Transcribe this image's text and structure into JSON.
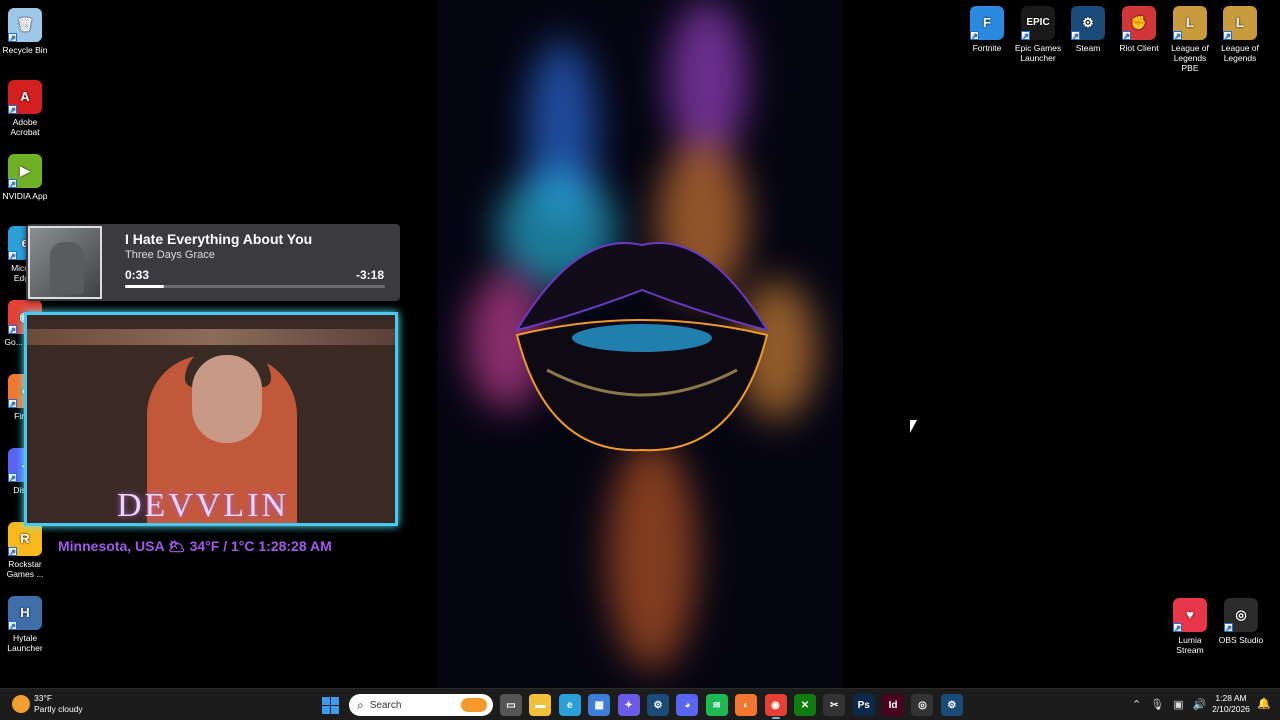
{
  "desktop_icons_left": [
    {
      "label": "Recycle Bin",
      "icon": "recycle-bin-icon",
      "glyph": "🗑",
      "color": "#9fc7e8"
    },
    {
      "label": "Adobe Acrobat",
      "icon": "adobe-acrobat-icon",
      "glyph": "A",
      "color": "#d21f1f"
    },
    {
      "label": "NVIDIA App",
      "icon": "nvidia-icon",
      "glyph": "▶",
      "color": "#6fb026"
    },
    {
      "label": "Micro... Edg...",
      "icon": "edge-icon",
      "glyph": "e",
      "color": "#2aa0d8"
    },
    {
      "label": "Go... Chr...",
      "icon": "chrome-icon",
      "glyph": "◉",
      "color": "#e44134"
    },
    {
      "label": "Fire...",
      "icon": "firefox-icon",
      "glyph": "◐",
      "color": "#f2762e"
    },
    {
      "label": "Disc...",
      "icon": "discord-icon",
      "glyph": "◕",
      "color": "#5865f2"
    },
    {
      "label": "Rockstar Games ...",
      "icon": "rockstar-icon",
      "glyph": "R",
      "color": "#f9b81b"
    },
    {
      "label": "Hytale Launcher",
      "icon": "hytale-icon",
      "glyph": "H",
      "color": "#3e6fa8"
    }
  ],
  "desktop_icons_right": [
    {
      "label": "Fortnite",
      "icon": "fortnite-icon",
      "glyph": "F",
      "color": "#2b8ae0"
    },
    {
      "label": "Epic Games Launcher",
      "icon": "epic-games-icon",
      "glyph": "EPIC",
      "color": "#1a1a1a"
    },
    {
      "label": "Steam",
      "icon": "steam-icon",
      "glyph": "⚙",
      "color": "#1b4b78"
    },
    {
      "label": "Riot Client",
      "icon": "riot-client-icon",
      "glyph": "✊",
      "color": "#d13639"
    },
    {
      "label": "League of Legends PBE",
      "icon": "league-pbe-icon",
      "glyph": "L",
      "color": "#c89b3c"
    },
    {
      "label": "League of Legends",
      "icon": "league-icon",
      "glyph": "L",
      "color": "#c89b3c"
    }
  ],
  "desktop_icons_bottom_right": [
    {
      "label": "Lumia Stream",
      "icon": "lumia-stream-icon",
      "glyph": "♥",
      "color": "#e8364b"
    },
    {
      "label": "OBS Studio",
      "icon": "obs-icon",
      "glyph": "◎",
      "color": "#2b2b2b"
    }
  ],
  "now_playing": {
    "title": "I Hate Everything About You",
    "artist": "Three Days Grace",
    "current_time": "0:33",
    "remaining_time": "-3:18",
    "progress": 0.15
  },
  "webcam": {
    "overlay_name": "DEVVLIN"
  },
  "location_bar": "Minnesota, USA 🌥 34°F / 1°C 1:28:28 AM",
  "taskbar": {
    "weather_temp": "33°F",
    "weather_desc": "Partly cloudy",
    "search_placeholder": "Search",
    "apps": [
      {
        "name": "task-view-icon",
        "glyph": "▭",
        "color": "#555"
      },
      {
        "name": "file-explorer-icon",
        "glyph": "▬",
        "color": "#f3c03a"
      },
      {
        "name": "edge-icon",
        "glyph": "e",
        "color": "#2aa0d8"
      },
      {
        "name": "microsoft-store-icon",
        "glyph": "▦",
        "color": "#3b7dd8"
      },
      {
        "name": "copilot-icon",
        "glyph": "✦",
        "color": "#6a5ae8"
      },
      {
        "name": "steam-icon",
        "glyph": "⚙",
        "color": "#1b4b78"
      },
      {
        "name": "discord-icon",
        "glyph": "◕",
        "color": "#5865f2"
      },
      {
        "name": "spotify-icon",
        "glyph": "≋",
        "color": "#1db954"
      },
      {
        "name": "firefox-icon",
        "glyph": "◐",
        "color": "#f2762e"
      },
      {
        "name": "chrome-icon",
        "glyph": "◉",
        "color": "#e44134",
        "active": true
      },
      {
        "name": "xbox-icon",
        "glyph": "✕",
        "color": "#107c10"
      },
      {
        "name": "snipping-tool-icon",
        "glyph": "✂",
        "color": "#333"
      },
      {
        "name": "photoshop-icon",
        "glyph": "Ps",
        "color": "#0b2a4a"
      },
      {
        "name": "indesign-icon",
        "glyph": "Id",
        "color": "#49021f"
      },
      {
        "name": "obs-icon",
        "glyph": "◎",
        "color": "#333"
      },
      {
        "name": "steam-2-icon",
        "glyph": "⚙",
        "color": "#1b4b78"
      }
    ],
    "time": "1:28 AM",
    "date": "2/10/2026"
  },
  "colors": {
    "accent": "#4ac8f0",
    "location_text": "#a05ae8"
  }
}
